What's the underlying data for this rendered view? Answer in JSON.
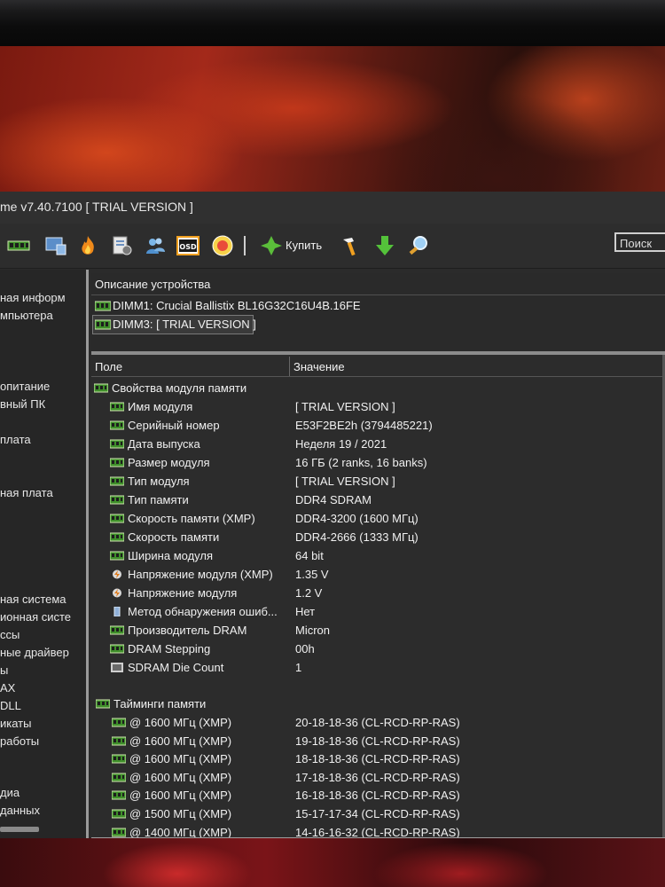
{
  "window": {
    "title": "me v7.40.7100  [ TRIAL VERSION ]"
  },
  "toolbar": {
    "buy_label": "Купить",
    "search_label": "Поиск",
    "icons": [
      "memory-icon",
      "monitor-icon",
      "flame-icon",
      "report-icon",
      "users-icon",
      "osd-icon",
      "sensor-icon",
      "buy-icon",
      "tools-icon",
      "download-icon",
      "search-icon"
    ]
  },
  "nav": {
    "items": [
      "ная информ",
      "мпьютера",
      "опитание",
      "вный ПК",
      "плата",
      "ная плата",
      "ная система",
      "ионная систе",
      "ссы",
      "ные драйвер",
      "ы",
      "AX",
      "DLL",
      "икаты",
      "работы",
      "диа",
      "данных"
    ]
  },
  "device_panel": {
    "header": "Описание устройства",
    "devices": [
      "DIMM1: Crucial Ballistix BL16G32C16U4B.16FE",
      "DIMM3: [ TRIAL VERSION ]"
    ]
  },
  "grid": {
    "col_field": "Поле",
    "col_value": "Значение",
    "section1": "Свойства модуля памяти",
    "props": [
      {
        "field": "Имя модуля",
        "value": "[ TRIAL VERSION ]",
        "icon": "memory-icon"
      },
      {
        "field": "Серийный номер",
        "value": "E53F2BE2h (3794485221)",
        "icon": "memory-icon"
      },
      {
        "field": "Дата выпуска",
        "value": "Неделя 19 / 2021",
        "icon": "memory-icon"
      },
      {
        "field": "Размер модуля",
        "value": "16 ГБ (2 ranks, 16 banks)",
        "icon": "memory-icon"
      },
      {
        "field": "Тип модуля",
        "value": "[ TRIAL VERSION ]",
        "icon": "memory-icon"
      },
      {
        "field": "Тип памяти",
        "value": "DDR4 SDRAM",
        "icon": "memory-icon"
      },
      {
        "field": "Скорость памяти (XMP)",
        "value": "DDR4-3200 (1600 МГц)",
        "icon": "memory-icon"
      },
      {
        "field": "Скорость памяти",
        "value": "DDR4-2666 (1333 МГц)",
        "icon": "memory-icon"
      },
      {
        "field": "Ширина модуля",
        "value": "64 bit",
        "icon": "memory-icon"
      },
      {
        "field": "Напряжение модуля (XMP)",
        "value": "1.35 V",
        "icon": "voltage-icon"
      },
      {
        "field": "Напряжение модуля",
        "value": "1.2 V",
        "icon": "voltage-icon"
      },
      {
        "field": "Метод обнаружения ошиб...",
        "value": "Нет",
        "icon": "device-icon"
      },
      {
        "field": "Производитель DRAM",
        "value": "Micron",
        "icon": "memory-icon"
      },
      {
        "field": "DRAM Stepping",
        "value": "00h",
        "icon": "memory-icon"
      },
      {
        "field": "SDRAM Die Count",
        "value": "1",
        "icon": "die-icon"
      }
    ],
    "section2": "Тайминги памяти",
    "timings": [
      {
        "field": "@ 1600 МГц (XMP)",
        "value": "20-18-18-36  (CL-RCD-RP-RAS)"
      },
      {
        "field": "@ 1600 МГц (XMP)",
        "value": "19-18-18-36  (CL-RCD-RP-RAS)"
      },
      {
        "field": "@ 1600 МГц (XMP)",
        "value": "18-18-18-36  (CL-RCD-RP-RAS)"
      },
      {
        "field": "@ 1600 МГц (XMP)",
        "value": "17-18-18-36  (CL-RCD-RP-RAS)"
      },
      {
        "field": "@ 1600 МГц (XMP)",
        "value": "16-18-18-36  (CL-RCD-RP-RAS)"
      },
      {
        "field": "@ 1500 МГц (XMP)",
        "value": "15-17-17-34  (CL-RCD-RP-RAS)"
      },
      {
        "field": "@ 1400 МГц (XMP)",
        "value": "14-16-16-32  (CL-RCD-RP-RAS)"
      }
    ]
  }
}
